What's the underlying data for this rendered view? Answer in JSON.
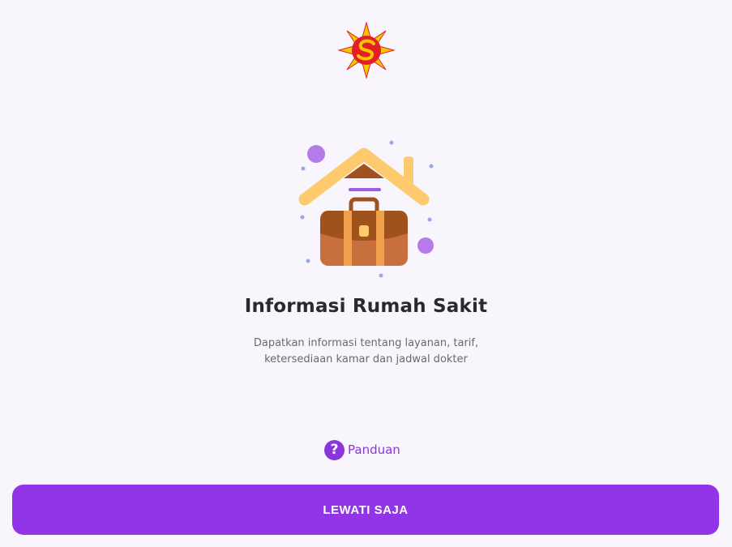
{
  "onboarding": {
    "title": "Informasi Rumah Sakit",
    "description_line1": "Dapatkan informasi tentang layanan, tarif,",
    "description_line2": "ketersediaan kamar dan jadwal dokter"
  },
  "guide": {
    "label": "Panduan",
    "icon_glyph": "?"
  },
  "skip_button": {
    "label": "LEWATI SAJA"
  },
  "colors": {
    "accent": "#9235e6",
    "background": "#f8f6fc",
    "roof": "#fdcb6e",
    "briefcase": "#c8703d",
    "briefcase_dark": "#9c4a20",
    "logo_sun": "#f7c600",
    "logo_red": "#e21f26"
  }
}
